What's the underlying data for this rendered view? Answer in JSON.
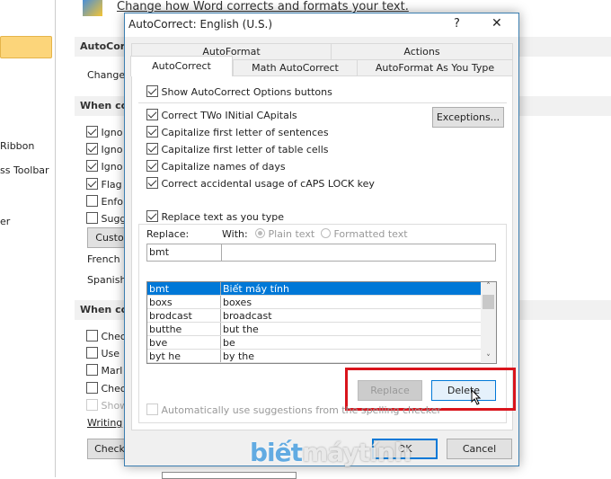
{
  "background": {
    "header_text": "Change how Word corrects and formats your text.",
    "left_items": [
      "Ribbon",
      "ss Toolbar",
      "er"
    ],
    "sections": [
      "AutoCorre",
      "When cor",
      "When cor"
    ],
    "change_label": "Change",
    "checks1": [
      {
        "label": "Igno",
        "checked": true
      },
      {
        "label": "Igno",
        "checked": true
      },
      {
        "label": "Igno",
        "checked": true
      },
      {
        "label": "Flag",
        "checked": true
      },
      {
        "label": "Enfo",
        "checked": false
      },
      {
        "label": "Sugg",
        "checked": false
      }
    ],
    "custom_btn": "Custo",
    "french": "French",
    "spanish": "Spanish",
    "checks2": [
      {
        "label": "Chec",
        "checked": false
      },
      {
        "label": "Use",
        "checked": false
      },
      {
        "label": "Marl",
        "checked": false
      },
      {
        "label": "Chec",
        "checked": false
      },
      {
        "label": "Show",
        "checked": false,
        "disabled": true
      }
    ],
    "writing": "Writing",
    "check_btn": "Check"
  },
  "dialog": {
    "title": "AutoCorrect: English (U.S.)",
    "help": "?",
    "close": "✕",
    "tabs_row1": [
      "AutoFormat",
      "Actions"
    ],
    "tabs_row2": [
      "AutoCorrect",
      "Math AutoCorrect",
      "AutoFormat As You Type"
    ],
    "active_tab": "AutoCorrect",
    "show_options": {
      "label": "Show AutoCorrect Options buttons",
      "checked": true
    },
    "options": [
      {
        "label": "Correct TWo INitial CApitals",
        "checked": true
      },
      {
        "label": "Capitalize first letter of sentences",
        "checked": true
      },
      {
        "label": "Capitalize first letter of table cells",
        "checked": true
      },
      {
        "label": "Capitalize names of days",
        "checked": true
      },
      {
        "label": "Correct accidental usage of cAPS LOCK key",
        "checked": true
      }
    ],
    "exceptions_btn": "Exceptions...",
    "replace_as_type": {
      "label": "Replace text as you type",
      "checked": true
    },
    "replace_label": "Replace:",
    "with_label": "With:",
    "plain_text": "Plain text",
    "formatted_text": "Formatted text",
    "replace_value": "bmt",
    "with_value": "",
    "entries": [
      {
        "replace": "bmt",
        "with": "Biết máy tính",
        "selected": true
      },
      {
        "replace": "boxs",
        "with": "boxes"
      },
      {
        "replace": "brodcast",
        "with": "broadcast"
      },
      {
        "replace": "butthe",
        "with": "but the"
      },
      {
        "replace": "bve",
        "with": "be"
      },
      {
        "replace": "byt he",
        "with": "by the"
      }
    ],
    "replace_btn": "Replace",
    "delete_btn": "Delete",
    "auto_suggest": {
      "label": "Automatically use suggestions from the spelling checker",
      "checked": false
    },
    "ok_btn": "OK",
    "cancel_btn": "Cancel",
    "highlight_color": "#d9141c"
  },
  "watermark": "biếtmáytính"
}
